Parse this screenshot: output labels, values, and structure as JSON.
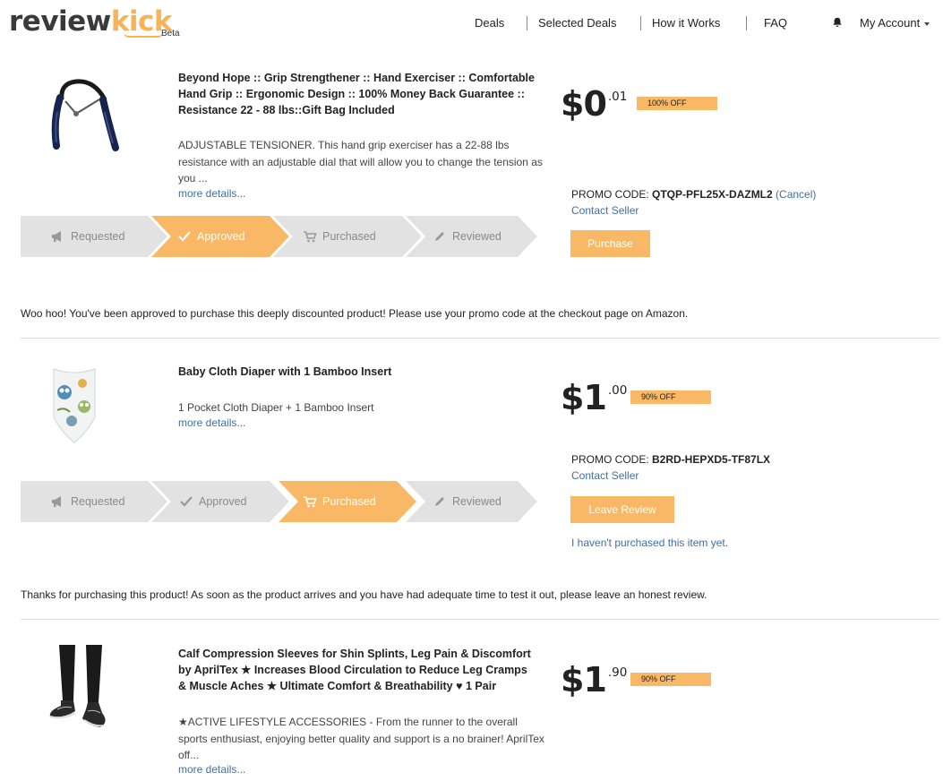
{
  "header": {
    "logo_part1": "review",
    "logo_part2": "kick",
    "logo_badge": "Beta",
    "nav": [
      "Deals",
      "Selected Deals",
      "How it Works",
      "FAQ"
    ],
    "account_label": "My Account",
    "brand_color": "#f8b865"
  },
  "products": [
    {
      "title": "Beyond Hope :: Grip Strengthener :: Hand Exerciser :: Comfortable Hand Grip :: Ergonomic Design :: 100% Money Back Guarantee :: Resistance 22 - 88 lbs::Gift Bag Included",
      "description": "ADJUSTABLE TENSIONER. This hand grip exerciser has a 22-88 lbs resistance with an adjustable dial that will allow you to change the tension as you ...",
      "more_link": "more details...",
      "price_dollars": "$0",
      "price_cents": ".01",
      "discount": "100% OFF",
      "promo_label": "PROMO CODE:",
      "promo_code": "QTQP-PFL25X-DAZML2",
      "promo_cancel": "(Cancel)",
      "contact_seller": "Contact Seller",
      "action_button": "Purchase",
      "steps": [
        "Requested",
        "Approved",
        "Purchased",
        "Reviewed"
      ],
      "active_step": "Approved",
      "status_message": "Woo hoo! You've been approved to purchase this deeply discounted product! Please use your promo code at the checkout page on Amazon."
    },
    {
      "title": "Baby Cloth Diaper with 1 Bamboo Insert",
      "description": "1 Pocket Cloth Diaper + 1 Bamboo Insert",
      "more_link": "more details...",
      "price_dollars": "$1",
      "price_cents": ".00",
      "discount": "90% OFF",
      "promo_label": "PROMO CODE:",
      "promo_code": "B2RD-HEPXD5-TF87LX",
      "contact_seller": "Contact Seller",
      "action_button": "Leave Review",
      "not_purchased_link": "I haven't purchased this item yet.",
      "steps": [
        "Requested",
        "Approved",
        "Purchased",
        "Reviewed"
      ],
      "active_step": "Purchased",
      "status_message": "Thanks for purchasing this product! As soon as the product arrives and you have had adequate time to test it out, please leave an honest review."
    },
    {
      "title": "Calf Compression Sleeves for Shin Splints, Leg Pain & Discomfort by AprilTex ★ Increases Blood Circulation to Reduce Leg Cramps & Muscle Aches ★ Ultimate Comfort & Breathability ♥ 1 Pair",
      "description": "★ACTIVE LIFESTYLE ACCESSORIES - From the runner to the overall sports enthusiast, enjoying better quality and support is a no brainer! AprilTex off...",
      "more_link": "more details...",
      "price_dollars": "$1",
      "price_cents": ".90",
      "discount": "90% OFF"
    }
  ]
}
